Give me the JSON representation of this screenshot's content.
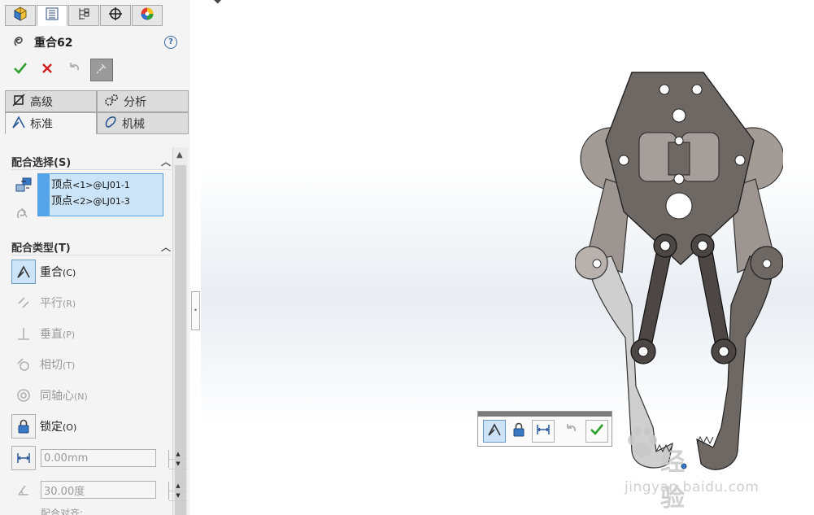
{
  "pm": {
    "title": "重合62",
    "help": "?"
  },
  "tabs": {
    "advanced": "高级",
    "analysis": "分析",
    "standard": "标准",
    "mechanical": "机械"
  },
  "mate_selection": {
    "header": "配合选择(S)",
    "items": [
      {
        "name": "顶点",
        "ref": "<1>@LJ01-1"
      },
      {
        "name": "顶点",
        "ref": "<2>@LJ01-3"
      }
    ]
  },
  "mate_types": {
    "header": "配合类型(T)",
    "items": [
      {
        "label": "重合",
        "key": "(C)"
      },
      {
        "label": "平行",
        "key": "(R)"
      },
      {
        "label": "垂直",
        "key": "(P)"
      },
      {
        "label": "相切",
        "key": "(T)"
      },
      {
        "label": "同轴心",
        "key": "(N)"
      },
      {
        "label": "锁定",
        "key": "(O)"
      }
    ],
    "distance_value": "0.00mm",
    "angle_value": "30.00度",
    "alignment_label": "配合对齐:"
  },
  "watermark": {
    "brand": "经验",
    "url": "jingyan.baidu.com"
  },
  "colors": {
    "accept": "#2e9e2e",
    "cancel": "#d21e1e",
    "selection_bg": "#cce4f7",
    "selection_bar": "#55a4ea",
    "part_dark": "#6e6864",
    "part_light": "#a69e9a",
    "part_pale": "#cfcfcf"
  },
  "icons": [
    "feature-manager-icon",
    "property-manager-icon",
    "configuration-manager-icon",
    "dimxpert-icon",
    "display-manager-icon",
    "mate-icon",
    "accept-icon",
    "cancel-icon",
    "undo-icon",
    "pin-icon",
    "coincident-icon",
    "parallel-icon",
    "perpendicular-icon",
    "tangent-icon",
    "concentric-icon",
    "lock-icon",
    "distance-icon",
    "angle-icon"
  ]
}
